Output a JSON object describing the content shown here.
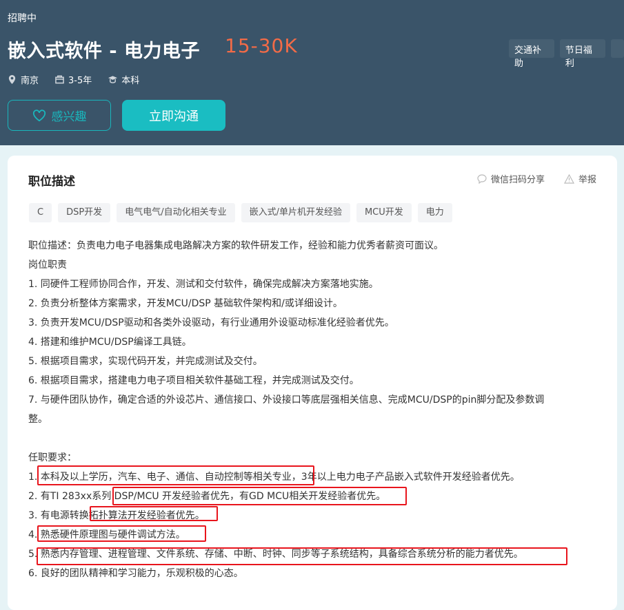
{
  "header": {
    "status": "招聘中",
    "title": "嵌入式软件 - 电力电子",
    "salary": "15-30K",
    "perks": [
      "交通补助",
      "节日福利"
    ],
    "meta": {
      "location": "南京",
      "experience": "3-5年",
      "education": "本科"
    },
    "interest_button": "感兴趣",
    "chat_button": "立即沟通",
    "colors": {
      "header_bg": "#3a5469",
      "accent": "#1abdc2",
      "salary": "#f26b47"
    }
  },
  "card": {
    "title": "职位描述",
    "share": "微信扫码分享",
    "report": "举报",
    "tags": [
      "C",
      "DSP开发",
      "电气电气/自动化相关专业",
      "嵌入式/单片机开发经验",
      "MCU开发",
      "电力"
    ],
    "lines": [
      "职位描述：负责电力电子电器集成电路解决方案的软件研发工作，经验和能力优秀者薪资可面议。",
      "岗位职责",
      "1. 同硬件工程师协同合作，开发、测试和交付软件，确保完成解决方案落地实施。",
      "2. 负责分析整体方案需求，开发MCU/DSP 基础软件架构和/或详细设计。",
      "3. 负责开发MCU/DSP驱动和各类外设驱动，有行业通用外设驱动标准化经验者优先。",
      "4. 搭建和维护MCU/DSP编译工具链。",
      "5. 根据项目需求，实现代码开发，并完成测试及交付。",
      "6. 根据项目需求，搭建电力电子项目相关软件基础工程，并完成测试及交付。",
      "7. 与硬件团队协作，确定合适的外设芯片、通信接口、外设接口等底层强相关信息、完成MCU/DSP的pin脚分配及参数调",
      "整。",
      "",
      "任职要求：",
      "1. 本科及以上学历，汽车、电子、通信、自动控制等相关专业，3年以上电力电子产品嵌入式软件开发经验者优先。",
      "2. 有TI 283xx系列 DSP/MCU 开发经验者优先，有GD MCU相关开发经验者优先。",
      "3. 有电源转换拓扑算法开发经验者优先。",
      "4. 熟悉硬件原理图与硬件调试方法。",
      "5. 熟悉内存管理、进程管理、文件系统、存储、中断、时钟、同步等子系统结构，具备综合系统分析的能力者优先。",
      "6. 良好的团队精神和学习能力，乐观积极的心态。"
    ]
  }
}
